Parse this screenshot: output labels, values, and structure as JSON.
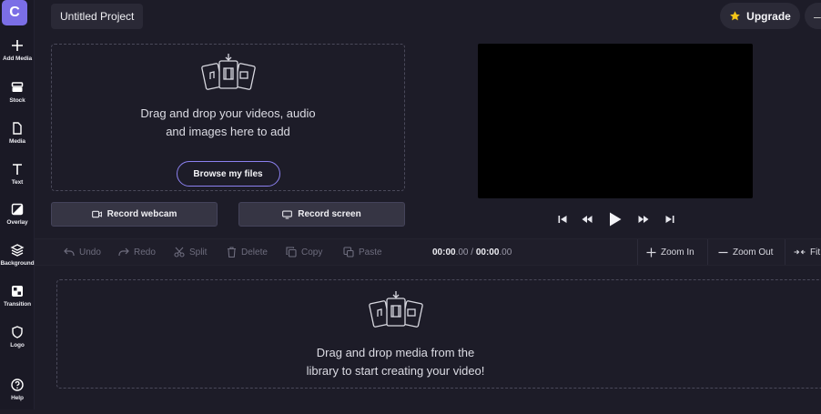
{
  "app": {
    "logo_letter": "C"
  },
  "sidebar": {
    "items": [
      {
        "label": "Add Media"
      },
      {
        "label": "Stock"
      },
      {
        "label": "Media"
      },
      {
        "label": "Text"
      },
      {
        "label": "Overlay"
      },
      {
        "label": "Background"
      },
      {
        "label": "Transition"
      },
      {
        "label": "Logo"
      },
      {
        "label": "Help"
      }
    ]
  },
  "header": {
    "project_title": "Untitled Project",
    "upgrade_label": "Upgrade"
  },
  "media_panel": {
    "drop_text_line1": "Drag and drop your videos, audio",
    "drop_text_line2": "and images here to add",
    "browse_label": "Browse my files",
    "record_webcam_label": "Record webcam",
    "record_screen_label": "Record screen"
  },
  "toolbar": {
    "undo": "Undo",
    "redo": "Redo",
    "split": "Split",
    "delete": "Delete",
    "copy": "Copy",
    "paste": "Paste",
    "time_current": "00:00",
    "time_current_frac": ".00",
    "time_sep": " / ",
    "time_total": "00:00",
    "time_total_frac": ".00",
    "zoom_in": "Zoom In",
    "zoom_out": "Zoom Out",
    "fit": "Fit"
  },
  "timeline": {
    "drop_text_line1": "Drag and drop media from the",
    "drop_text_line2": "library to start creating your video!"
  },
  "colors": {
    "accent": "#7b6ee6",
    "background": "#1d1c28",
    "star": "#f5c518"
  }
}
